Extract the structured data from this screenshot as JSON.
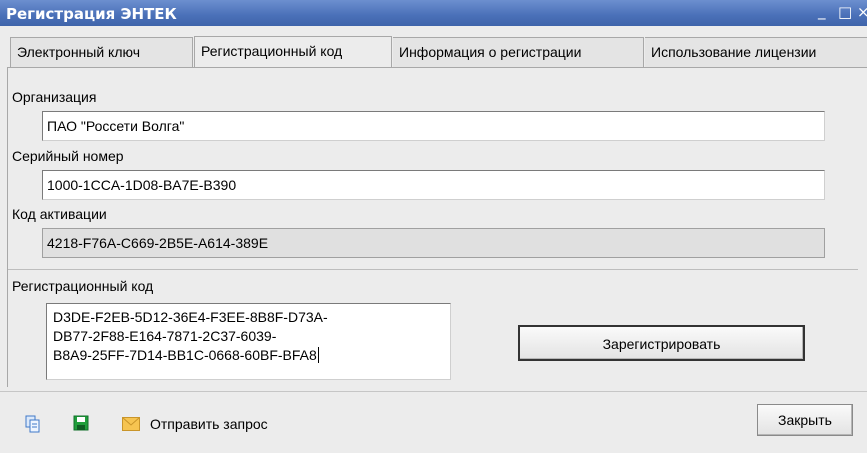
{
  "window": {
    "title": "Регистрация ЭНТЕК",
    "minimize": "_",
    "maximize": "□",
    "close": "×"
  },
  "tabs": [
    {
      "label": "Электронный ключ"
    },
    {
      "label": "Регистрационный код"
    },
    {
      "label": "Информация о регистрации"
    },
    {
      "label": "Использование лицензии"
    }
  ],
  "form": {
    "organization_label": "Организация",
    "organization_value": "ПАО \"Россети Волга\"",
    "serial_label": "Серийный номер",
    "serial_value": "1000-1CCA-1D08-BA7E-B390",
    "activation_label": "Код активации",
    "activation_value": "4218-F76A-C669-2B5E-A614-389E",
    "regcode_label": "Регистрационный код",
    "regcode_lines": [
      "D3DE-F2EB-5D12-36E4-F3EE-8B8F-D73A-",
      "DB77-2F88-E164-7871-2C37-6039-",
      "B8A9-25FF-7D14-BB1C-0668-60BF-BFA8"
    ],
    "register_button": "Зарегистрировать"
  },
  "footer": {
    "send_request": "Отправить запрос",
    "close_button": "Закрыть",
    "icons": [
      "copy-icon",
      "save-icon",
      "envelope-icon"
    ]
  },
  "colors": {
    "titlebar": "#4a70b8",
    "background": "#ececec"
  }
}
